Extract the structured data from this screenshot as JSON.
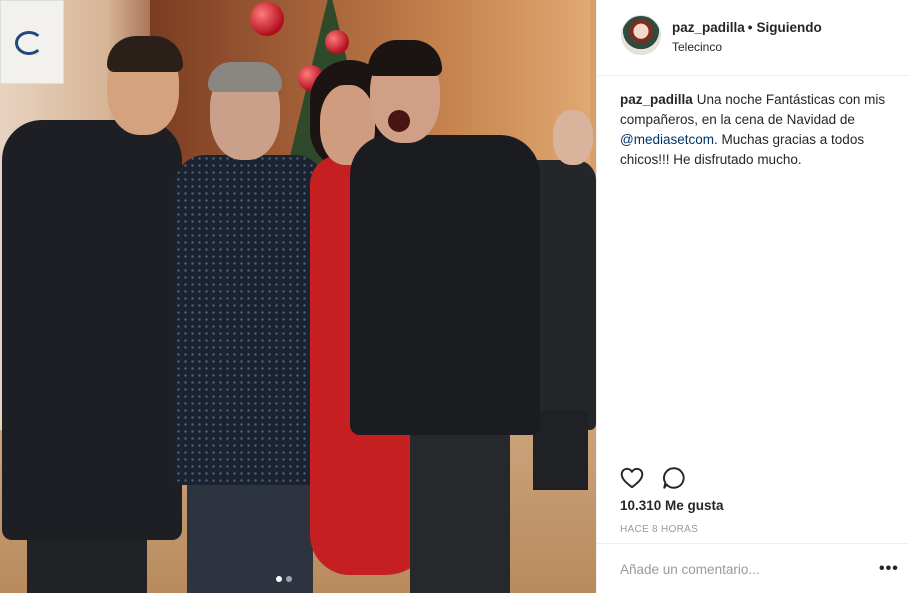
{
  "post": {
    "username": "paz_padilla",
    "separator": "•",
    "follow_status": "Siguiendo",
    "location": "Telecinco",
    "caption": {
      "author": "paz_padilla",
      "text_before": "Una noche Fantásticas con mis compañeros, en la cena de Navidad de",
      "mention": "@mediasetcom",
      "text_after": ". Muchas gracias a todos chicos!!! He disfrutado mucho."
    },
    "likes_label": "10.310 Me gusta",
    "time_label": "HACE 8 HORAS",
    "comment_placeholder": "Añade un comentario...",
    "more_label": "•••"
  },
  "icons": {
    "like": "heart-icon",
    "comment": "comment-bubble-icon",
    "more": "more-options-icon"
  },
  "carousel": {
    "total_slides": 2,
    "active_slide": 1
  },
  "colors": {
    "mention": "#003569",
    "muted": "#999999",
    "text": "#262626",
    "divider": "#efefef"
  }
}
